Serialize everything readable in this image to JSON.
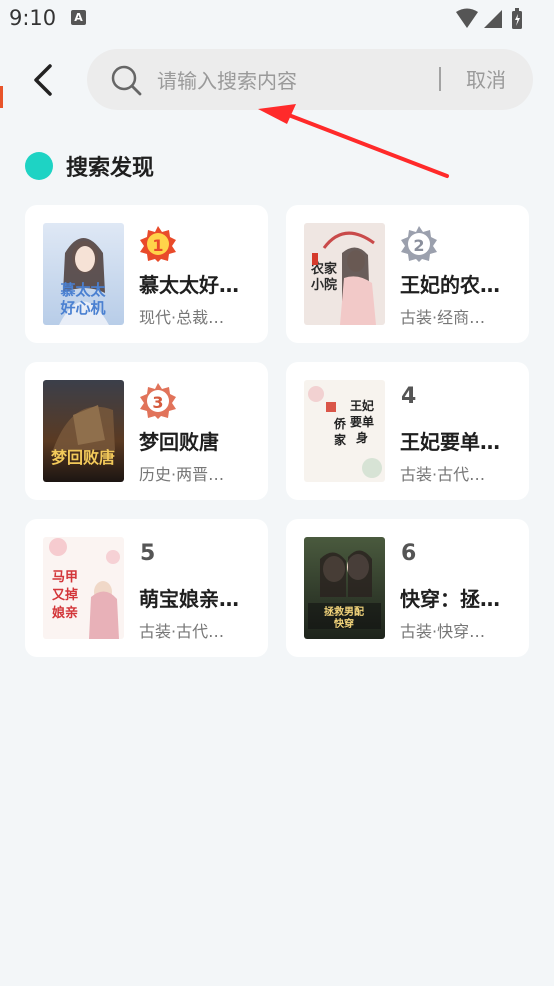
{
  "status_bar": {
    "time": "9:10",
    "notification_glyph": "A"
  },
  "search": {
    "placeholder": "请输入搜索内容",
    "cancel_label": "取消"
  },
  "section": {
    "title": "搜索发现"
  },
  "colors": {
    "accent_teal": "#1ed3c4",
    "rank_1": "#e94a2a",
    "rank_2": "#9ba0ad",
    "rank_3": "#e1735a",
    "annotation_arrow": "#ff2a2a"
  },
  "books": [
    {
      "rank": "1",
      "title": "慕太太好…",
      "tags": "现代·总裁…",
      "cover_text": "慕太太好心机"
    },
    {
      "rank": "2",
      "title": "王妃的农…",
      "tags": "古装·经商…",
      "cover_text": "农家小院"
    },
    {
      "rank": "3",
      "title": "梦回败唐",
      "tags": "历史·两晋…",
      "cover_text": "梦回败唐"
    },
    {
      "rank": "4",
      "title": "王妃要单…",
      "tags": "古装·古代…",
      "cover_text": "王妃要单身"
    },
    {
      "rank": "5",
      "title": "萌宝娘亲…",
      "tags": "古装·古代…",
      "cover_text": "马甲又掉了萌宝娘亲"
    },
    {
      "rank": "6",
      "title": "快穿：拯…",
      "tags": "古装·快穿…",
      "cover_text": "快穿"
    }
  ]
}
